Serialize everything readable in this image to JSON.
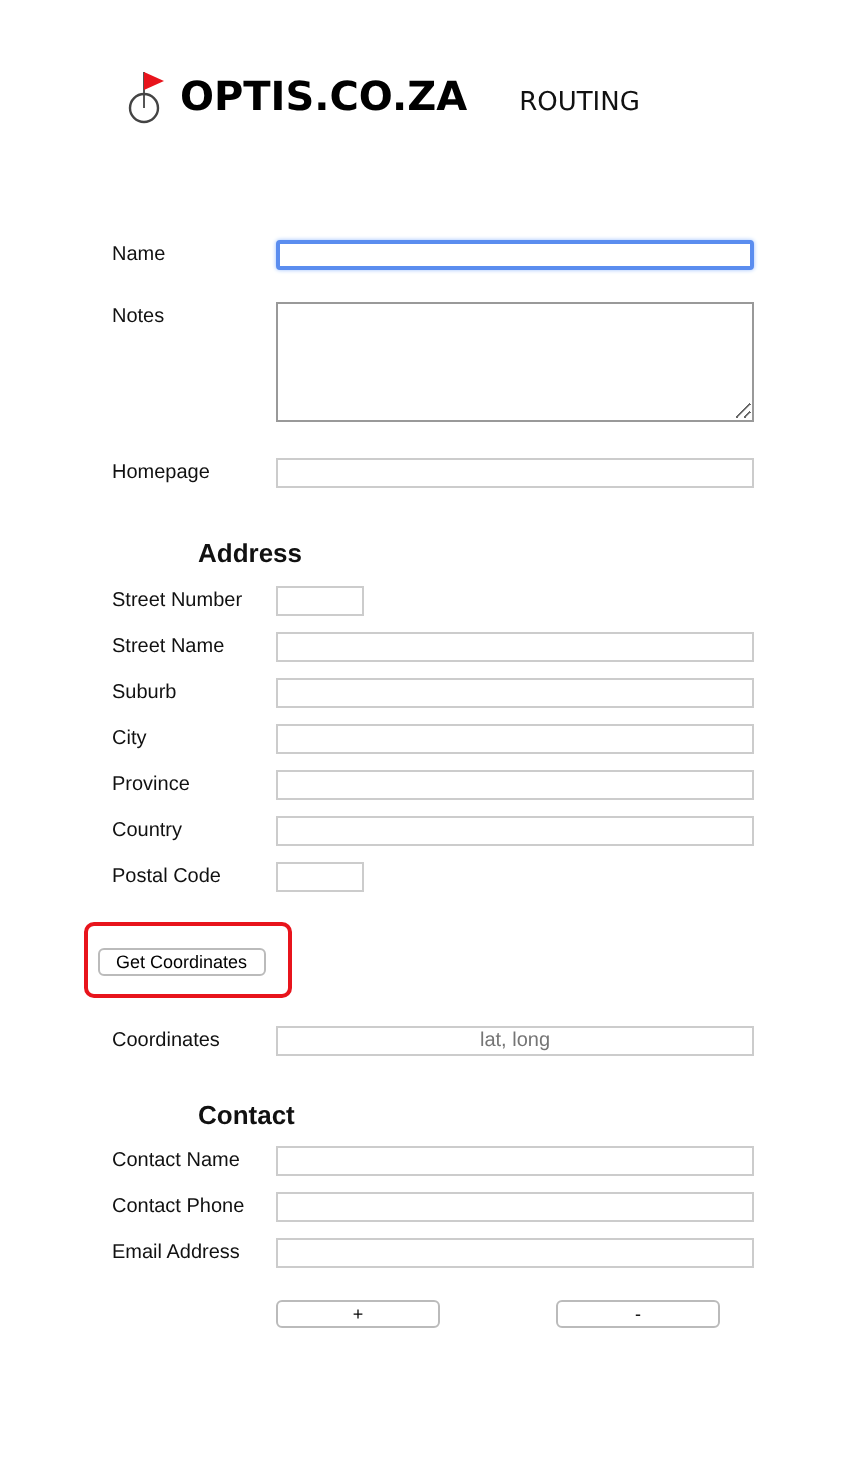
{
  "logo": {
    "brand": "OPTIS.CO.ZA",
    "subtitle": "ROUTING"
  },
  "general": [
    {
      "label": "Name",
      "kind": "text",
      "focused": true
    },
    {
      "label": "Notes",
      "kind": "textarea",
      "focused": false
    },
    {
      "label": "Homepage",
      "kind": "text",
      "focused": false
    }
  ],
  "address": {
    "heading": "Address",
    "fields": [
      {
        "label": "Street Number",
        "kind": "short",
        "focused": false
      },
      {
        "label": "Street Name",
        "kind": "text",
        "focused": false
      },
      {
        "label": "Suburb",
        "kind": "text",
        "focused": false
      },
      {
        "label": "City",
        "kind": "text",
        "focused": false
      },
      {
        "label": "Province",
        "kind": "text",
        "focused": false
      },
      {
        "label": "Country",
        "kind": "text",
        "focused": false
      },
      {
        "label": "Postal Code",
        "kind": "short",
        "focused": false
      }
    ],
    "button": {
      "label": "Get Coordinates",
      "highlighted": true
    },
    "coordinates": {
      "label": "Coordinates",
      "placeholder": "lat, long"
    }
  },
  "contact": {
    "heading": "Contact",
    "fields": [
      {
        "label": "Contact Name",
        "kind": "text",
        "focused": false
      },
      {
        "label": "Contact Phone",
        "kind": "text",
        "focused": false
      },
      {
        "label": "Email Address",
        "kind": "text",
        "focused": false
      }
    ]
  },
  "buttons": [
    "+",
    "-"
  ]
}
